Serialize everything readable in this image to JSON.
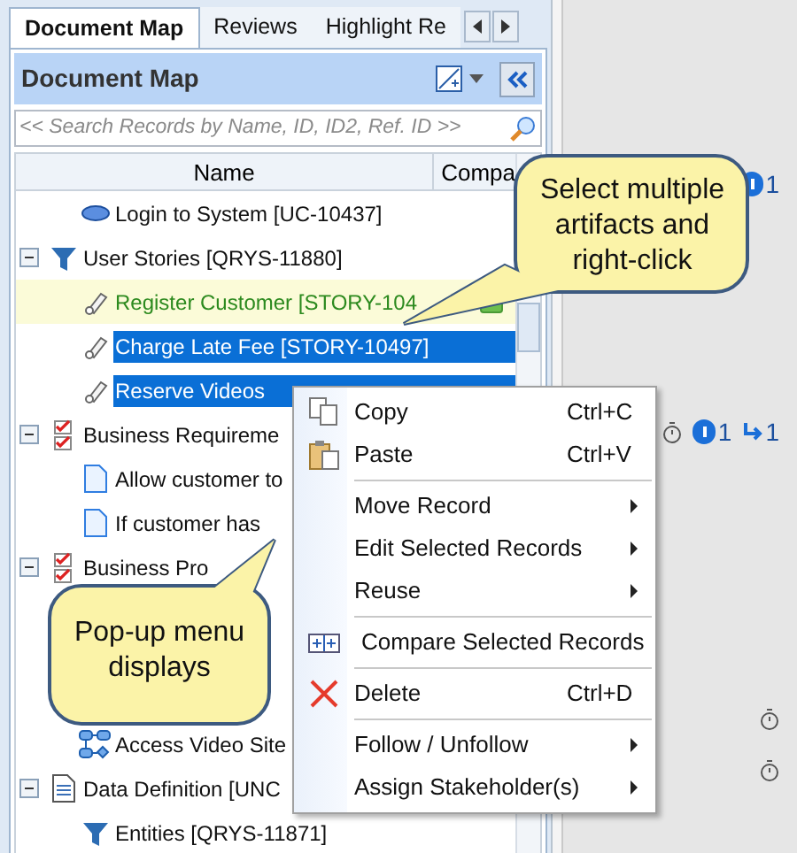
{
  "tabs": [
    {
      "label": "Document Map",
      "selected": true
    },
    {
      "label": "Reviews",
      "selected": false
    },
    {
      "label": "Highlight Re",
      "selected": false
    }
  ],
  "panel": {
    "title": "Document Map"
  },
  "search": {
    "placeholder": "<< Search Records by Name, ID, ID2, Ref. ID >>"
  },
  "table": {
    "columns": [
      "Name",
      "Compa"
    ]
  },
  "tree": [
    {
      "children": [
        {
          "label": "Login to System [UC-10437]",
          "kind": "usecase",
          "selected": false,
          "highlighted": false
        }
      ]
    },
    {
      "label": "User Stories [QRYS-11880]",
      "kind": "filter",
      "expanded": true,
      "selected": false,
      "highlighted": false,
      "children": [
        {
          "label": "Register Customer [STORY-104",
          "kind": "story",
          "selected": false,
          "highlighted": true
        },
        {
          "label": "Charge Late Fee [STORY-10497]",
          "kind": "story",
          "selected": true,
          "highlighted": false
        },
        {
          "label": "Reserve Videos",
          "kind": "story",
          "selected": true,
          "highlighted": false
        }
      ]
    },
    {
      "label": "Business Requireme",
      "kind": "checklist",
      "expanded": true,
      "selected": false,
      "highlighted": false,
      "children": [
        {
          "label": "Allow customer to",
          "kind": "document",
          "selected": false,
          "highlighted": false
        },
        {
          "label": "If customer has",
          "kind": "document",
          "selected": false,
          "highlighted": false
        }
      ]
    },
    {
      "label": "Business Pro",
      "kind": "checklist",
      "expanded": true,
      "selected": false,
      "highlighted": false,
      "children": [
        {
          "kind": "covered"
        },
        {
          "kind": "covered"
        },
        {
          "kind": "covered"
        },
        {
          "label": "Access Video Site",
          "kind": "process",
          "selected": false,
          "highlighted": false
        }
      ]
    },
    {
      "label": "Data Definition [UNC",
      "kind": "datadoc",
      "expanded": true,
      "selected": false,
      "highlighted": false,
      "children": [
        {
          "label": "Entities [QRYS-11871]",
          "kind": "filter",
          "selected": false,
          "highlighted": false
        }
      ]
    }
  ],
  "indicators": [
    {
      "badges": [
        {
          "kind": "alert",
          "count": "1"
        }
      ]
    },
    {
      "badges": [
        {
          "kind": "timer"
        },
        {
          "kind": "alert",
          "count": "1"
        },
        {
          "kind": "link",
          "count": "1"
        }
      ]
    },
    {
      "badges": [
        {
          "kind": "timer"
        }
      ]
    },
    {
      "badges": [
        {
          "kind": "timer"
        }
      ]
    }
  ],
  "context_menu": [
    {
      "kind": "copy",
      "label": "Copy",
      "shortcut": "Ctrl+C",
      "submenu": false
    },
    {
      "kind": "paste",
      "label": "Paste",
      "shortcut": "Ctrl+V",
      "submenu": false
    },
    {
      "kind": "separator"
    },
    {
      "kind": "item",
      "label": "Move Record",
      "submenu": true
    },
    {
      "kind": "item",
      "label": "Edit Selected Records",
      "submenu": true
    },
    {
      "kind": "item",
      "label": "Reuse",
      "submenu": true
    },
    {
      "kind": "separator"
    },
    {
      "kind": "compare",
      "label": "Compare Selected Records",
      "submenu": false
    },
    {
      "kind": "separator"
    },
    {
      "kind": "delete",
      "label": "Delete",
      "shortcut": "Ctrl+D",
      "submenu": false
    },
    {
      "kind": "separator"
    },
    {
      "kind": "item",
      "label": "Follow / Unfollow",
      "submenu": true
    },
    {
      "kind": "item",
      "label": "Assign Stakeholder(s)",
      "submenu": true
    }
  ],
  "callouts": [
    {
      "text": "Select multiple artifacts and right-click"
    },
    {
      "text": "Pop-up menu displays"
    }
  ]
}
